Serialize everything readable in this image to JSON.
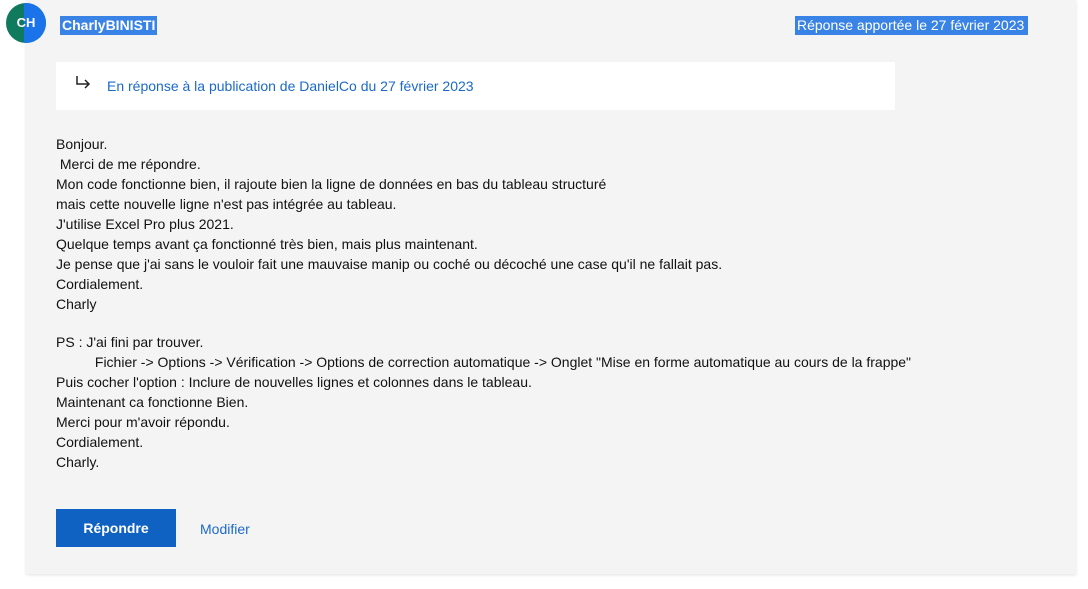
{
  "post": {
    "avatar_initials": "CH",
    "author": "CharlyBINISTI",
    "date": "Réponse apportée le 27 février 2023",
    "reply_reference": "En réponse à la publication de DanielCo du 27 février 2023",
    "body_lines": [
      "Bonjour.",
      " Merci de me répondre.",
      "Mon code fonctionne bien, il rajoute bien la ligne de données en bas du tableau structuré",
      "mais cette nouvelle ligne n'est pas intégrée au tableau.",
      "J'utilise Excel Pro plus 2021.",
      "Quelque temps avant ça fonctionné très bien, mais plus maintenant.",
      "Je pense que j'ai sans le vouloir fait une mauvaise manip ou coché ou décoché une case qu'il ne fallait pas.",
      "Cordialement.",
      "Charly",
      "",
      "PS : J'ai fini par trouver.",
      "          Fichier -> Options -> Vérification -> Options de correction automatique -> Onglet \"Mise en forme automatique au cours de la frappe\"",
      "Puis cocher l'option : Inclure de nouvelles lignes et colonnes dans le tableau.",
      "Maintenant ca fonctionne Bien.",
      "Merci pour m'avoir répondu.",
      "Cordialement.",
      "Charly."
    ]
  },
  "actions": {
    "reply_label": "Répondre",
    "edit_label": "Modifier"
  },
  "colors": {
    "accent": "#0f62c2",
    "link": "#1b6ac9",
    "selection": "#3a83e6",
    "avatar": "#0f7a5e"
  },
  "icons": {
    "reply_reference": "reply-arrow-icon"
  }
}
